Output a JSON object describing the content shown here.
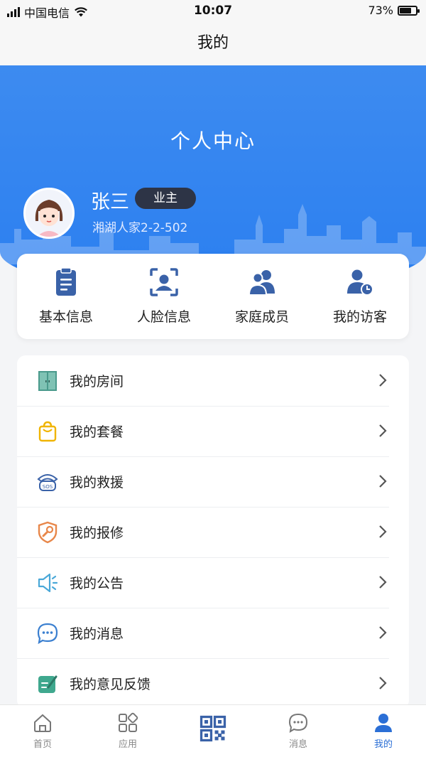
{
  "status_bar": {
    "carrier": "中国电信",
    "time": "10:07",
    "battery": "73%",
    "battery_level": 0.73
  },
  "nav": {
    "title": "我的"
  },
  "profile": {
    "header": "个人中心",
    "name": "张三",
    "role": "业主",
    "address": "湘湖人家2-2-502"
  },
  "quick_actions": [
    {
      "label": "基本信息",
      "icon": "clipboard-icon"
    },
    {
      "label": "人脸信息",
      "icon": "face-scan-icon"
    },
    {
      "label": "家庭成员",
      "icon": "family-icon"
    },
    {
      "label": "我的访客",
      "icon": "visitor-icon"
    }
  ],
  "menu": [
    {
      "label": "我的房间",
      "icon": "room-icon"
    },
    {
      "label": "我的套餐",
      "icon": "package-icon"
    },
    {
      "label": "我的救援",
      "icon": "sos-phone-icon"
    },
    {
      "label": "我的报修",
      "icon": "repair-icon"
    },
    {
      "label": "我的公告",
      "icon": "announcement-icon"
    },
    {
      "label": "我的消息",
      "icon": "message-icon"
    },
    {
      "label": "我的意见反馈",
      "icon": "feedback-icon"
    }
  ],
  "tabs": [
    {
      "label": "首页",
      "icon": "home-icon"
    },
    {
      "label": "应用",
      "icon": "apps-icon"
    },
    {
      "label": "",
      "icon": "qr-code-icon"
    },
    {
      "label": "消息",
      "icon": "chat-icon"
    },
    {
      "label": "我的",
      "icon": "user-icon",
      "active": true
    }
  ],
  "colors": {
    "accent": "#2b7ff0",
    "active_tab": "#2b6fd6",
    "icon_blue": "#3a62a8"
  }
}
